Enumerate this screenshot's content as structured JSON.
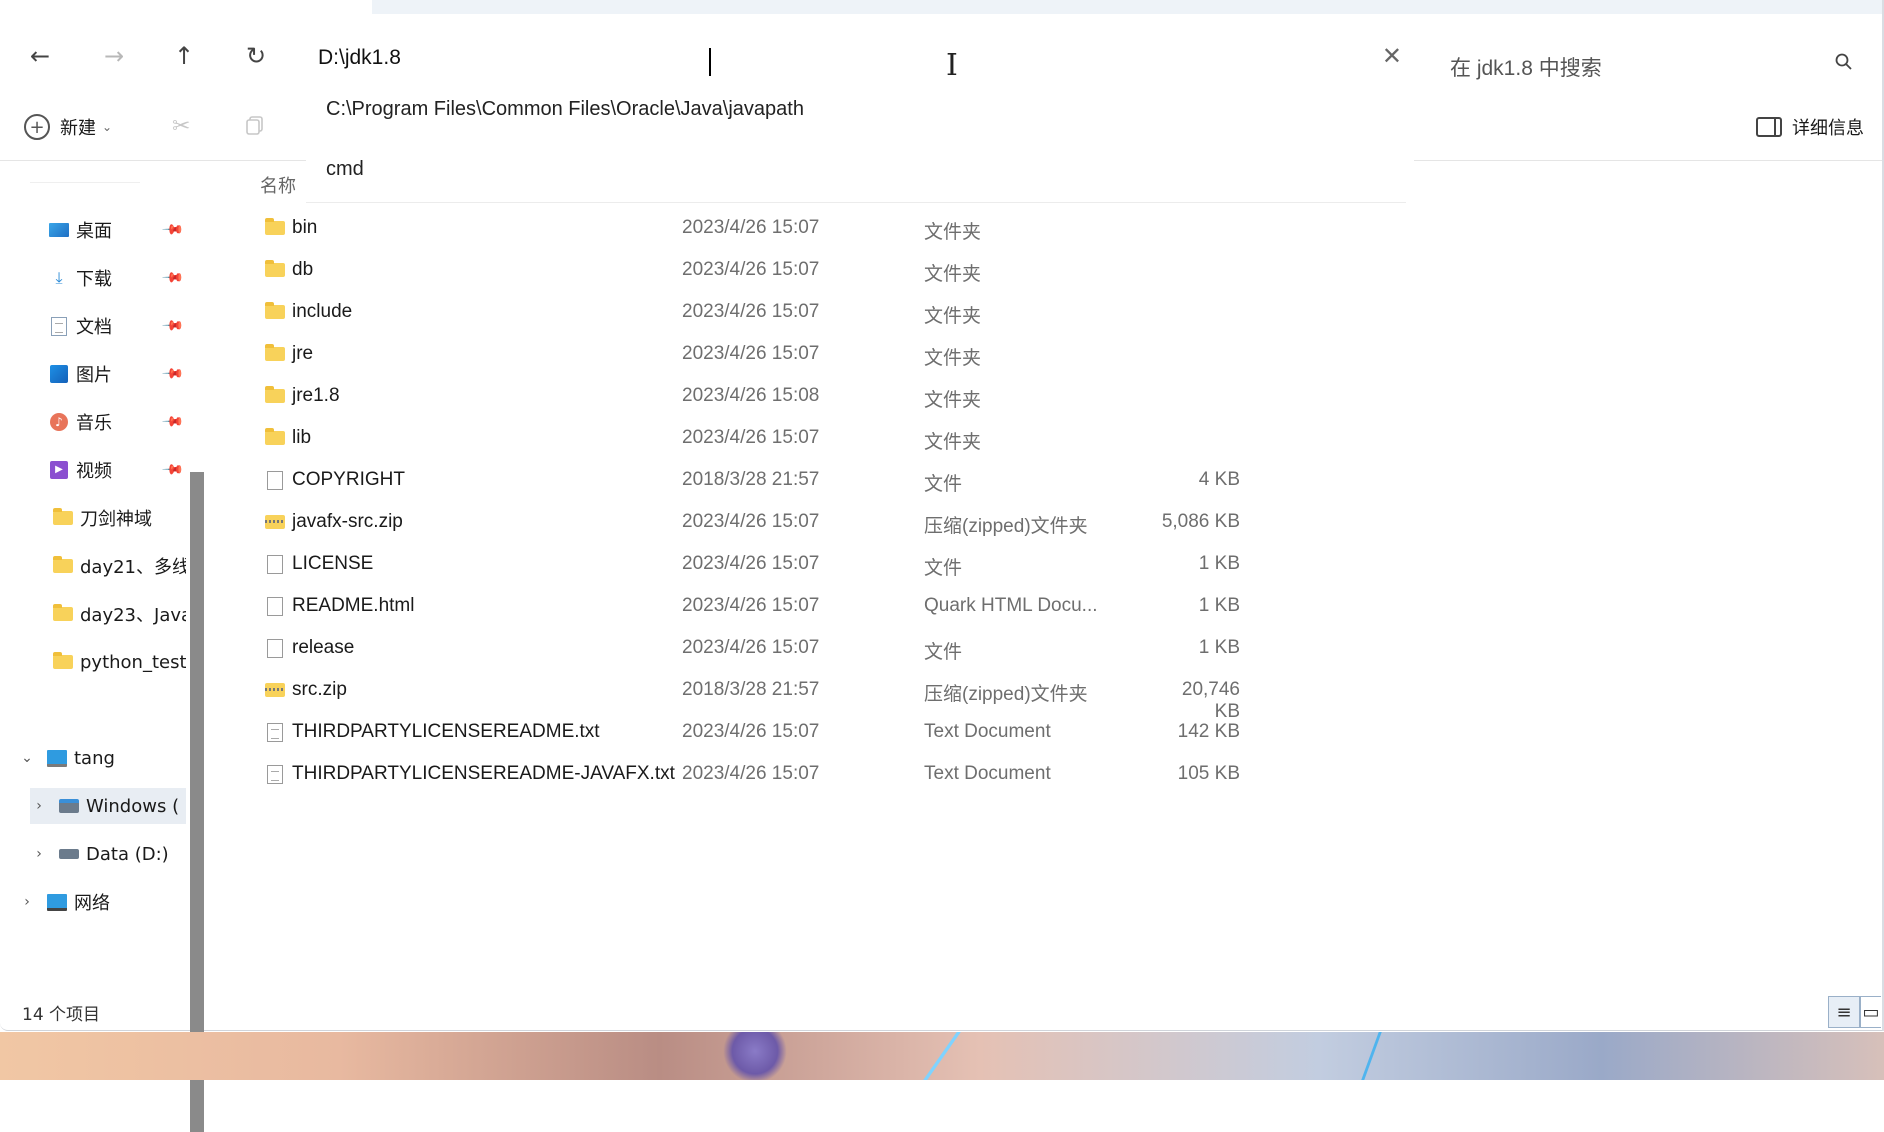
{
  "window": {
    "title": "jdk1.8"
  },
  "navigation": {
    "back": "←",
    "forward": "→",
    "up": "↑",
    "refresh": "↻"
  },
  "address_bar": {
    "value": "D:\\jdk1.8",
    "clear": "✕",
    "suggestions": [
      "C:\\Program Files\\Common Files\\Oracle\\Java\\javapath",
      "cmd"
    ]
  },
  "search": {
    "placeholder": "在 jdk1.8 中搜索"
  },
  "toolbar": {
    "new_label": "新建",
    "details_label": "详细信息"
  },
  "sidebar": {
    "quick_access": [
      {
        "label": "桌面",
        "icon": "desktop-icon",
        "pinned": true
      },
      {
        "label": "下载",
        "icon": "download-icon",
        "pinned": true
      },
      {
        "label": "文档",
        "icon": "document-icon",
        "pinned": true
      },
      {
        "label": "图片",
        "icon": "pictures-icon",
        "pinned": true
      },
      {
        "label": "音乐",
        "icon": "music-icon",
        "pinned": true
      },
      {
        "label": "视频",
        "icon": "video-icon",
        "pinned": true
      },
      {
        "label": "刀剑神域",
        "icon": "folder-icon",
        "pinned": false
      },
      {
        "label": "day21、多线",
        "icon": "folder-icon",
        "pinned": false
      },
      {
        "label": "day23、Java",
        "icon": "folder-icon",
        "pinned": false
      },
      {
        "label": "python_test",
        "icon": "folder-icon",
        "pinned": false
      }
    ],
    "tree": [
      {
        "label": "tang",
        "icon": "computer-icon",
        "expanded": true
      },
      {
        "label": "Windows (",
        "icon": "drive-icon",
        "expanded": false
      },
      {
        "label": "Data (D:)",
        "icon": "drive-icon",
        "expanded": false
      },
      {
        "label": "网络",
        "icon": "network-icon",
        "expanded": false
      }
    ]
  },
  "file_list": {
    "header_name": "名称",
    "rows": [
      {
        "name": "bin",
        "date": "2023/4/26 15:07",
        "type": "文件夹",
        "size": "",
        "icon": "folder"
      },
      {
        "name": "db",
        "date": "2023/4/26 15:07",
        "type": "文件夹",
        "size": "",
        "icon": "folder"
      },
      {
        "name": "include",
        "date": "2023/4/26 15:07",
        "type": "文件夹",
        "size": "",
        "icon": "folder"
      },
      {
        "name": "jre",
        "date": "2023/4/26 15:07",
        "type": "文件夹",
        "size": "",
        "icon": "folder"
      },
      {
        "name": "jre1.8",
        "date": "2023/4/26 15:08",
        "type": "文件夹",
        "size": "",
        "icon": "folder"
      },
      {
        "name": "lib",
        "date": "2023/4/26 15:07",
        "type": "文件夹",
        "size": "",
        "icon": "folder"
      },
      {
        "name": "COPYRIGHT",
        "date": "2018/3/28 21:57",
        "type": "文件",
        "size": "4 KB",
        "icon": "file"
      },
      {
        "name": "javafx-src.zip",
        "date": "2023/4/26 15:07",
        "type": "压缩(zipped)文件夹",
        "size": "5,086 KB",
        "icon": "zip"
      },
      {
        "name": "LICENSE",
        "date": "2023/4/26 15:07",
        "type": "文件",
        "size": "1 KB",
        "icon": "file"
      },
      {
        "name": "README.html",
        "date": "2023/4/26 15:07",
        "type": "Quark HTML Docu...",
        "size": "1 KB",
        "icon": "file"
      },
      {
        "name": "release",
        "date": "2023/4/26 15:07",
        "type": "文件",
        "size": "1 KB",
        "icon": "file"
      },
      {
        "name": "src.zip",
        "date": "2018/3/28 21:57",
        "type": "压缩(zipped)文件夹",
        "size": "20,746 KB",
        "icon": "zip"
      },
      {
        "name": "THIRDPARTYLICENSEREADME.txt",
        "date": "2023/4/26 15:07",
        "type": "Text Document",
        "size": "142 KB",
        "icon": "text"
      },
      {
        "name": "THIRDPARTYLICENSEREADME-JAVAFX.txt",
        "date": "2023/4/26 15:07",
        "type": "Text Document",
        "size": "105 KB",
        "icon": "text"
      }
    ]
  },
  "status_bar": {
    "item_count": "14 个项目"
  },
  "colors": {
    "accent": "#2b5d8c",
    "folder": "#f8d25a",
    "text_secondary": "#6e6e6e"
  }
}
